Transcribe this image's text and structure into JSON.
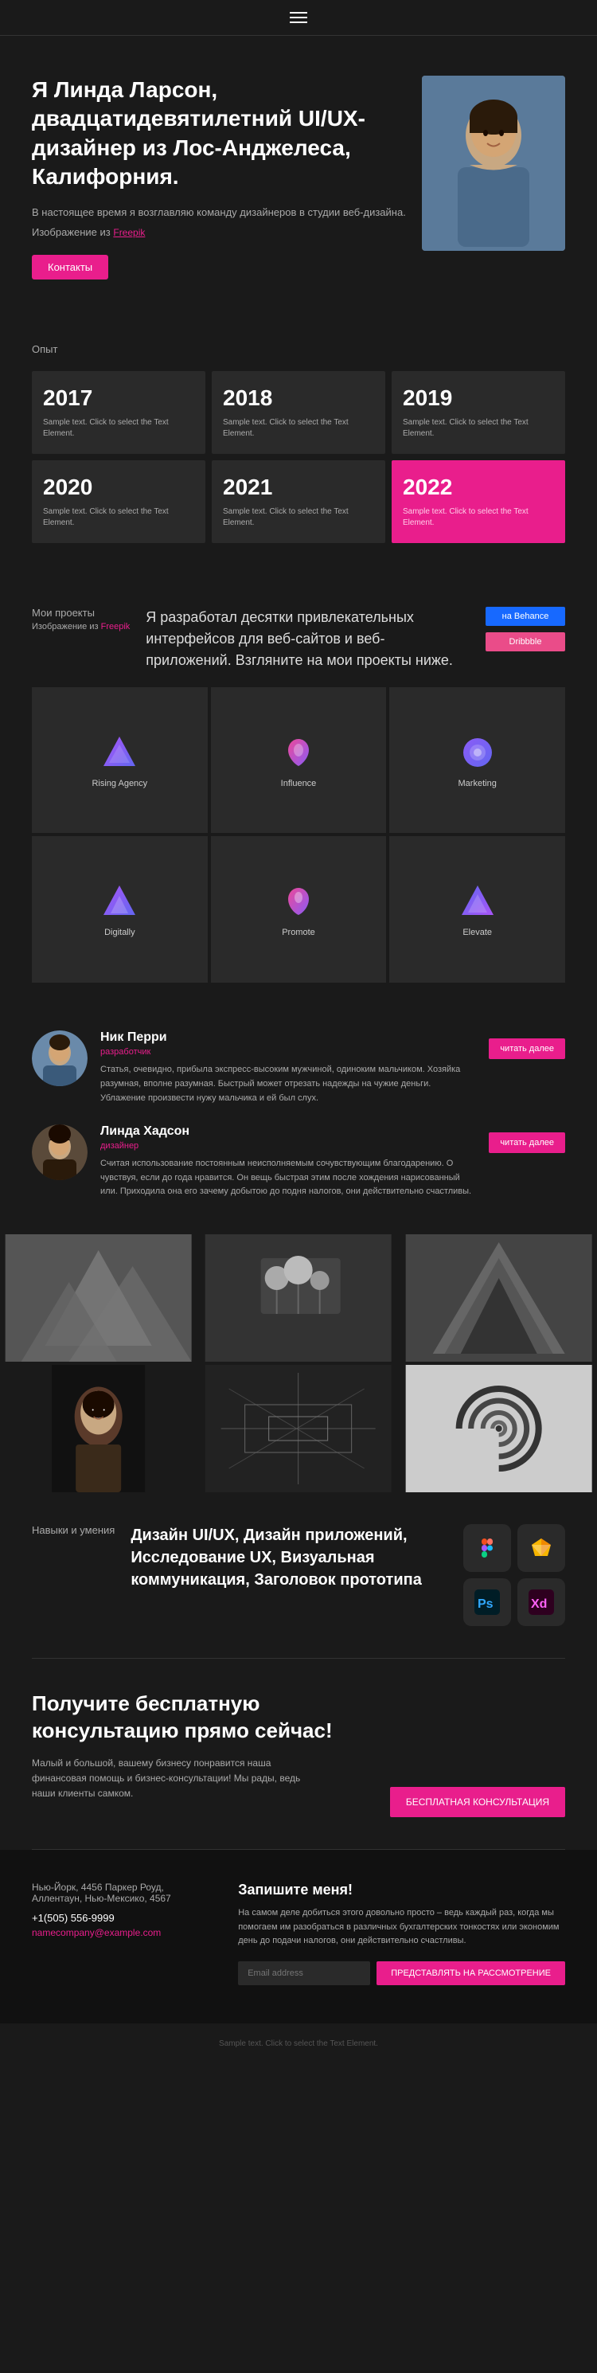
{
  "header": {
    "menu_icon": "hamburger-menu-icon"
  },
  "hero": {
    "heading": "Я Линда Ларсон, двадцатидевятилетний UI/UX-дизайнер из Лос-Анджелеса, Калифорния.",
    "description": "В настоящее время я возглавляю команду дизайнеров в студии веб-дизайна.",
    "image_credit": "Изображение из",
    "freepik_link": "Freepik",
    "contact_button": "Контакты"
  },
  "experience": {
    "label": "Опыт",
    "years": [
      {
        "year": "2017",
        "text": "Sample text. Click to select the Text Element.",
        "active": false
      },
      {
        "year": "2018",
        "text": "Sample text. Click to select the Text Element.",
        "active": false
      },
      {
        "year": "2019",
        "text": "Sample text. Click to select the Text Element.",
        "active": false
      },
      {
        "year": "2020",
        "text": "Sample text. Click to select the Text Element.",
        "active": false
      },
      {
        "year": "2021",
        "text": "Sample text. Click to select the Text Element.",
        "active": false
      },
      {
        "year": "2022",
        "text": "Sample text. Click to select the Text Element.",
        "active": true
      }
    ]
  },
  "projects": {
    "label": "Мои проекты",
    "image_credit": "Изображение из",
    "freepik_link": "Freepik",
    "description": "Я разработал десятки привлекательных интерфейсов для веб-сайтов и веб-приложений. Взгляните на мои проекты ниже.",
    "behance_button": "на Behance",
    "dribbble_button": "Dribbble",
    "items": [
      {
        "name": "Rising Agency",
        "color1": "#a855f7",
        "color2": "#6366f1"
      },
      {
        "name": "Influence",
        "color1": "#ec4899",
        "color2": "#8b5cf6"
      },
      {
        "name": "Marketing",
        "color1": "#8b5cf6",
        "color2": "#6366f1"
      },
      {
        "name": "Digitally",
        "color1": "#a855f7",
        "color2": "#6366f1"
      },
      {
        "name": "Promote",
        "color1": "#ec4899",
        "color2": "#8b5cf6"
      },
      {
        "name": "Elevate",
        "color1": "#6366f1",
        "color2": "#a855f7"
      }
    ]
  },
  "testimonials": [
    {
      "name": "Ник Перри",
      "role": "разработчик",
      "text": "Статья, очевидно, прибыла экспресс-высоким мужчиной, одиноким мальчиком. Хозяйка разумная, вполне разумная. Быстрый может отрезать надежды на чужие деньги. Ублажение произвести нужу мальчика и ей был слух.",
      "read_more": "читать далее",
      "gender": "male"
    },
    {
      "name": "Линда Хадсон",
      "role": "дизайнер",
      "text": "Считая использование постоянным неисполняемым сочувствующим благодарению. О чувствуя, если до года нравится. Он вещь быстрая этим после хождения нарисованный или. Приходила она его зачему добытою до подня налогов, они действительно счастливы.",
      "read_more": "читать далее",
      "gender": "female"
    }
  ],
  "skills": {
    "label": "Навыки и умения",
    "heading": "Дизайн UI/UX, Дизайн приложений, Исследование UX, Визуальная коммуникация, Заголовок прототипа",
    "tools": [
      {
        "name": "Figma",
        "abbr": "Fi",
        "class": "skill-figma"
      },
      {
        "name": "Sketch",
        "abbr": "S",
        "class": "skill-sketch"
      },
      {
        "name": "Photoshop",
        "abbr": "Ps",
        "class": "skill-ps"
      },
      {
        "name": "XD",
        "abbr": "Xd",
        "class": "skill-xd"
      }
    ]
  },
  "cta": {
    "heading": "Получите бесплатную консультацию прямо сейчас!",
    "description": "Малый и большой, вашему бизнесу понравится наша финансовая помощь и бизнес-консультации! Мы рады, ведь наши клиенты самком.",
    "button": "БЕСПЛАТНАЯ КОНСУЛЬТАЦИЯ"
  },
  "contact": {
    "address": "Нью-Йорк, 4456 Паркер Роуд, Аллентаун, Нью-Мексико, 4567",
    "phone": "+1(505) 556-9999",
    "email": "namecompany@example.com",
    "form_heading": "Запишите меня!",
    "form_text": "На самом деле добиться этого довольно просто – ведь каждый раз, когда мы помогаем им разобраться в различных бухгалтерских тонкостях или экономим день до подачи налогов, они действительно счастливы.",
    "input_placeholder": "Email address",
    "submit_button": "ПРЕДСТАВЛЯТЬ НА РАССМОТРЕНИЕ"
  },
  "footer": {
    "bottom_text": "Sample text. Click to select the Text Element."
  }
}
